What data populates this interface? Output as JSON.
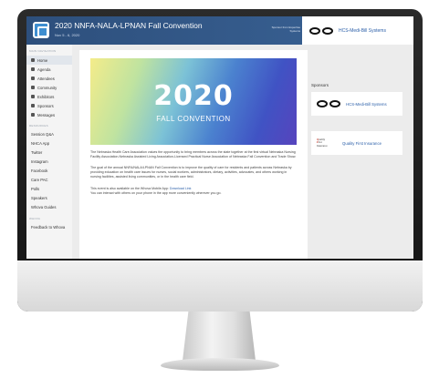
{
  "header": {
    "title": "2020 NNFA-NALA-LPNAN Fall Convention",
    "dates": "Nov 5 - 6, 2020",
    "sponsor_note": "Sponsor from Expertise Systems",
    "ad_label": "HCS-Medi-Bill Systems"
  },
  "sidebar": {
    "main_section": "MAIN NAVIGATION",
    "main_items": [
      {
        "label": "Home",
        "icon": "home-icon"
      },
      {
        "label": "Agenda",
        "icon": "calendar-icon"
      },
      {
        "label": "Attendees",
        "icon": "people-icon"
      },
      {
        "label": "Community",
        "icon": "chat-icon"
      },
      {
        "label": "Exhibitors",
        "icon": "building-icon"
      },
      {
        "label": "Sponsors",
        "icon": "badge-icon"
      },
      {
        "label": "Messages",
        "icon": "envelope-icon"
      }
    ],
    "resources_section": "RESOURCES",
    "resource_items": [
      "Session Q&A",
      "NHCA App",
      "Twitter",
      "Instagram",
      "Facebook",
      "Care PAC",
      "Polls",
      "Speakers",
      "Whova Guides"
    ],
    "whova_section": "WHOVA",
    "whova_items": [
      "Feedback to Whova"
    ]
  },
  "banner": {
    "year": "2020",
    "subtitle": "FALL CONVENTION"
  },
  "content": {
    "p1": "The Nebraska Health Care Association values the opportunity to bring members across the state together at the first virtual Nebraska Nursing Facility Association-Nebraska Assisted Living Association-Licensed Practical Nurse Association of Nebraska Fall Convention and Trade Show.",
    "p2": "The goal of the annual NNFA/NALA/LPNAN Fall Convention is to improve the quality of care for residents and patients across Nebraska by providing education on health care issues for nurses, social workers, administrators, dietary, activities, advocates, and others working in nursing facilities, assisted living communities, or in the health care field.",
    "p3_prefix": "This event is also available on the Whova Mobile App:",
    "p3_link": "Download Link",
    "p3_suffix": "You can interact with others on your phone in the app more conveniently wherever you go."
  },
  "sponsors": {
    "title": "Sponsors",
    "items": [
      {
        "name": "HCS-Medi-Bill Systems"
      },
      {
        "name": "Quality First Insurance"
      }
    ]
  }
}
